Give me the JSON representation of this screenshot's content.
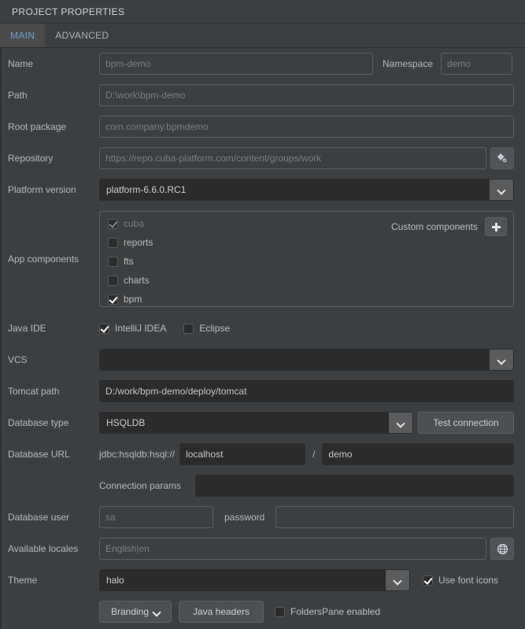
{
  "window": {
    "title": "PROJECT PROPERTIES"
  },
  "tabs": [
    {
      "label": "MAIN",
      "active": true
    },
    {
      "label": "ADVANCED",
      "active": false
    }
  ],
  "form": {
    "name": {
      "label": "Name",
      "placeholder": "bpm-demo",
      "value": ""
    },
    "namespace": {
      "label": "Namespace",
      "placeholder": "demo",
      "value": ""
    },
    "path": {
      "label": "Path",
      "placeholder": "D:\\work\\bpm-demo",
      "value": ""
    },
    "root_package": {
      "label": "Root package",
      "placeholder": "com.company.bpmdemo",
      "value": ""
    },
    "repository": {
      "label": "Repository",
      "placeholder": "https://repo.cuba-platform.com/content/groups/work",
      "value": "",
      "button_icon": "gear-icon"
    },
    "platform_version": {
      "label": "Platform version",
      "value": "platform-6.6.0.RC1"
    },
    "app_components": {
      "label": "App components",
      "custom_components_label": "Custom components",
      "add_button_icon": "plus-icon",
      "items": [
        {
          "label": "cuba",
          "checked": true,
          "disabled": true
        },
        {
          "label": "reports",
          "checked": false,
          "disabled": false
        },
        {
          "label": "fts",
          "checked": false,
          "disabled": false
        },
        {
          "label": "charts",
          "checked": false,
          "disabled": false
        },
        {
          "label": "bpm",
          "checked": true,
          "disabled": false
        }
      ]
    },
    "java_ide": {
      "label": "Java IDE",
      "options": [
        {
          "label": "IntelliJ IDEA",
          "checked": true
        },
        {
          "label": "Eclipse",
          "checked": false
        }
      ]
    },
    "vcs": {
      "label": "VCS",
      "value": ""
    },
    "tomcat_path": {
      "label": "Tomcat path",
      "value": "D:/work/bpm-demo/deploy/tomcat"
    },
    "database_type": {
      "label": "Database type",
      "value": "HSQLDB",
      "test_connection_label": "Test connection"
    },
    "database_url": {
      "label": "Database URL",
      "prefix": "jdbc:hsqldb:hsql://",
      "host": "localhost",
      "separator": "/",
      "database": "demo"
    },
    "connection_params": {
      "label": "Connection params",
      "value": ""
    },
    "database_user": {
      "label": "Database user",
      "placeholder": "sa",
      "value": "",
      "password_label": "password",
      "password_value": ""
    },
    "available_locales": {
      "label": "Available locales",
      "placeholder": "English|en",
      "value": "",
      "button_icon": "globe-icon"
    },
    "theme": {
      "label": "Theme",
      "value": "halo",
      "use_font_icons_label": "Use font icons",
      "use_font_icons_checked": true
    },
    "bottom": {
      "branding_label": "Branding",
      "java_headers_label": "Java headers",
      "folders_pane_label": "FoldersPane enabled",
      "folders_pane_checked": false
    }
  },
  "colors": {
    "background": "#3c3f41",
    "input_dark": "#2b2b2b",
    "accent_tab": "#6aa0d8",
    "border": "#5e6060"
  }
}
